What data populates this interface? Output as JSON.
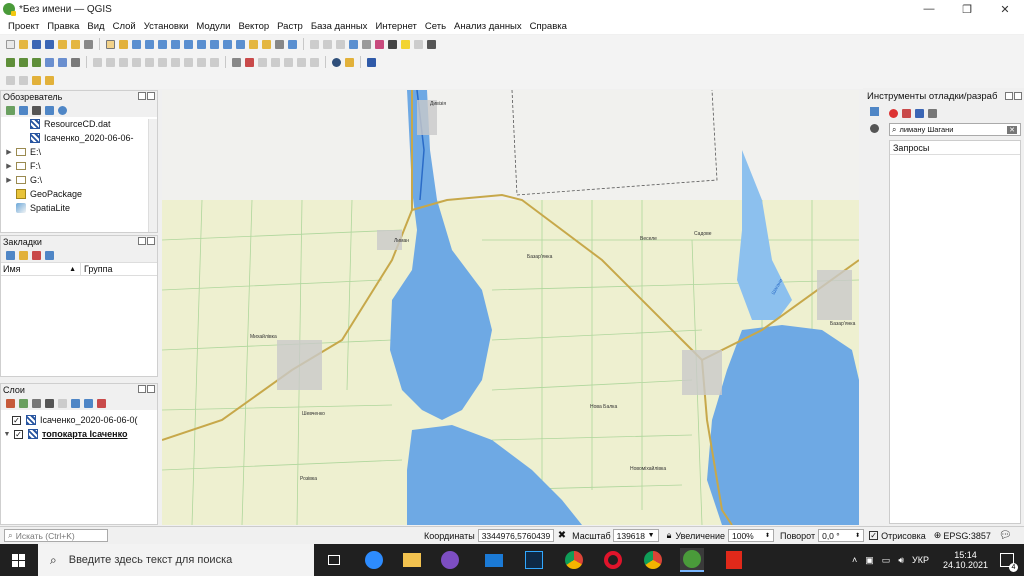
{
  "window": {
    "title": "*Без имени — QGIS",
    "controls": [
      "—",
      "❐",
      "✕"
    ]
  },
  "menubar": [
    "Проект",
    "Правка",
    "Вид",
    "Слой",
    "Установки",
    "Модули",
    "Вектор",
    "Растр",
    "База данных",
    "Интернет",
    "Сеть",
    "Анализ данных",
    "Справка"
  ],
  "browser": {
    "title": "Обозреватель",
    "items": [
      {
        "label": "ResourceCD.dat",
        "icon": "raster-icon",
        "indent": 2
      },
      {
        "label": "Ісаченко_2020-06-06-",
        "icon": "raster-icon",
        "indent": 2
      },
      {
        "label": "E:\\",
        "icon": "folder-icon",
        "indent": 1
      },
      {
        "label": "F:\\",
        "icon": "folder-icon",
        "indent": 1
      },
      {
        "label": "G:\\",
        "icon": "folder-icon",
        "indent": 1
      },
      {
        "label": "GeoPackage",
        "icon": "geopackage-icon",
        "indent": 1
      },
      {
        "label": "SpatiaLite",
        "icon": "spatialite-icon",
        "indent": 1
      }
    ]
  },
  "bookmarks": {
    "title": "Закладки",
    "columns": [
      "Имя",
      "Группа"
    ]
  },
  "layers": {
    "title": "Слои",
    "items": [
      {
        "label": "Ісаченко_2020-06-06-0(",
        "checked": true,
        "bold": false
      },
      {
        "label": "топокарта Ісаченко",
        "checked": true,
        "bold": true
      }
    ]
  },
  "debug_panel": {
    "title": "Инструменты отладки/разраб",
    "search_value": "лиману Шагани",
    "requests_label": "Запросы"
  },
  "map": {
    "labels": {
      "top_village": "Дивізія",
      "north_village": "Лиман",
      "mid_village": "Базар'янка",
      "east_village1": "Веселе",
      "east_village2": "Садове",
      "west_village": "Михайлівка",
      "sw_village": "Шевченко",
      "southwest2": "Розівка",
      "se_village": "Базар'янка",
      "south_v1": "Нова Балка",
      "south_v2": "Новоміхайлівка",
      "lake_label": "Шагани"
    }
  },
  "statusbar": {
    "search_placeholder": "Искать (Ctrl+K)",
    "coord_label": "Координаты",
    "coord_value": "3344976,5760439",
    "scale_label": "Масштаб",
    "scale_value": "139618",
    "zoom_label": "Увеличение",
    "zoom_value": "100%",
    "rotation_label": "Поворот",
    "rotation_value": "0,0 °",
    "render_label": "Отрисовка",
    "render_checked": true,
    "crs": "EPSG:3857"
  },
  "taskbar": {
    "search_placeholder": "Введите здесь текст для поиска",
    "lang": "УКР",
    "time": "15:14",
    "date": "24.10.2021",
    "notifications": "4"
  }
}
